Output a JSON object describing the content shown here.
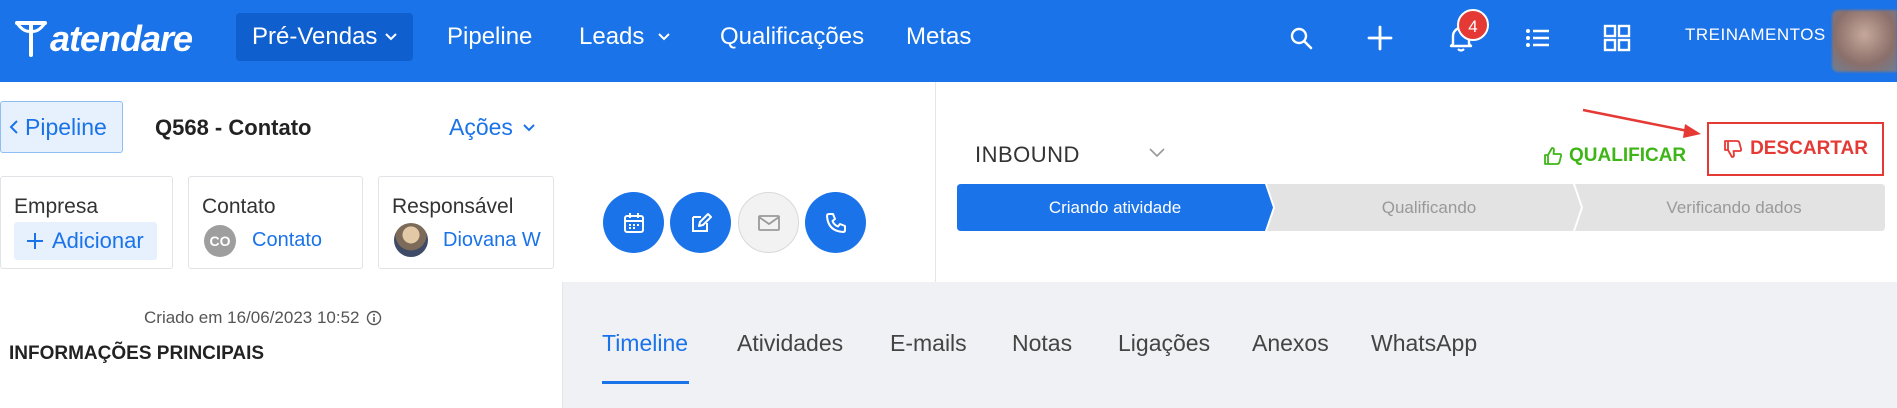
{
  "brand": "atendare",
  "nav": {
    "items": [
      {
        "label": "Pré-Vendas",
        "dropdown": true,
        "active": true
      },
      {
        "label": "Pipeline",
        "dropdown": false
      },
      {
        "label": "Leads",
        "dropdown": true
      },
      {
        "label": "Qualificações",
        "dropdown": false
      },
      {
        "label": "Metas",
        "dropdown": false
      }
    ],
    "notification_count": "4",
    "user_label": "TREINAMENTOS",
    "icons": [
      "search-icon",
      "plus-icon",
      "bell-icon",
      "list-icon",
      "grid-icon"
    ]
  },
  "header": {
    "back_label": "Pipeline",
    "title": "Q568 - Contato",
    "actions_label": "Ações",
    "cards": {
      "empresa": {
        "label": "Empresa",
        "add_label": "Adicionar"
      },
      "contato": {
        "label": "Contato",
        "initials": "CO",
        "value": "Contato"
      },
      "responsavel": {
        "label": "Responsável",
        "value": "Diovana W"
      }
    },
    "action_icons": [
      "calendar-icon",
      "edit-icon",
      "mail-icon",
      "phone-icon"
    ]
  },
  "pipeline": {
    "source": "INBOUND",
    "qualify_label": "QUALIFICAR",
    "discard_label": "DESCARTAR",
    "steps": [
      "Criando atividade",
      "Qualificando",
      "Verificando dados"
    ],
    "active_step": 0,
    "colors": {
      "active": "#1a73e8",
      "inactive": "#e3e3e3",
      "qualify": "#3fb618",
      "discard": "#e53935"
    }
  },
  "details": {
    "created": "Criado em 16/06/2023 10:52",
    "section_title": "INFORMAÇÕES PRINCIPAIS"
  },
  "tabs": {
    "items": [
      "Timeline",
      "Atividades",
      "E-mails",
      "Notas",
      "Ligações",
      "Anexos",
      "WhatsApp"
    ],
    "active": "Timeline"
  }
}
